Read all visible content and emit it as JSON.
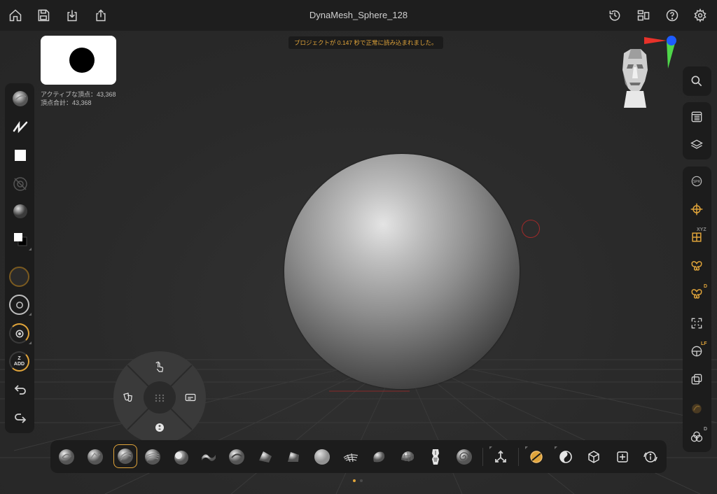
{
  "header": {
    "title": "DynaMesh_Sphere_128",
    "left_buttons": [
      "home-icon",
      "save-icon",
      "import-icon",
      "share-icon"
    ],
    "right_buttons": [
      "history-icon",
      "layout-icon",
      "help-icon",
      "settings-icon"
    ]
  },
  "viewport": {
    "notification": "プロジェクトが 0.147 秒で正常に読み込まれました。",
    "stats": {
      "active_points": "アクティブな頂点：43,368",
      "total_points": "頂点合計：43,368"
    }
  },
  "left_toolbar": {
    "z_add_label": "Z\nADD"
  },
  "radial_menu": {
    "center_icon": "grid-icon"
  },
  "bottom_brushes": [
    "Standard",
    "Clay",
    "ClayBuildup",
    "ClayTubes",
    "Inflate",
    "Move",
    "Dam_Standard",
    "hPolish",
    "TrimDynamic",
    "Smooth",
    "Pinch",
    "Snakehook",
    "Flatten",
    "SkinShade",
    "Mannequin",
    "Spiral"
  ],
  "selected_brush_index": 2,
  "colors": {
    "accent": "#e0a43a",
    "panel": "#1c1c1c",
    "topbar": "#1e1e1e",
    "viewport": "#2a2a2a",
    "brush_cursor": "#a12a2a",
    "axis_x": "#e8322a",
    "axis_y": "#1d5cff",
    "axis_z": "#4fd64a"
  }
}
